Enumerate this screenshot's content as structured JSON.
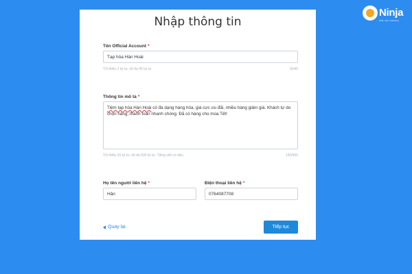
{
  "logo": {
    "brand": "Ninja",
    "tagline": "Phần mềm marketing"
  },
  "form": {
    "title": "Nhập thông tin",
    "oa_name": {
      "label": "Tên Official Account",
      "required_mark": "*",
      "value": "Tạp hóa Hàn Hoài",
      "hint": "Tối thiểu 2 ký tự, tối đa 40 ký tự",
      "counter": "16/40"
    },
    "description": {
      "label": "Thông tin mô tả",
      "required_mark": "*",
      "parts": [
        {
          "text": "Tiệm tạp hóa Hàn Hoài",
          "sp": true
        },
        {
          "text": " có đa dạng hàng hóa, giá cực ưu đãi, nhiều hàng giảm giá. Khách tự do chọn hàng, thanh toán nhanh chóng. Đã có hàng cho mùa Tết!",
          "sp": false
        }
      ],
      "hint": "Tối thiểu 20 ký tự, tối đa 500 ký tự. Tiếng việt có dấu.",
      "counter": "150/500"
    },
    "contact_name": {
      "label": "Họ tên người liên hệ",
      "required_mark": "*",
      "value": "Hân"
    },
    "phone": {
      "label": "Điện thoại liên hệ",
      "required_mark": "*",
      "value": "0764087708"
    },
    "back_label": "Quay lại",
    "next_label": "Tiếp tục"
  },
  "colors": {
    "background": "#2d8cf0",
    "primary_button": "#1e88d9",
    "required": "#e03131"
  }
}
